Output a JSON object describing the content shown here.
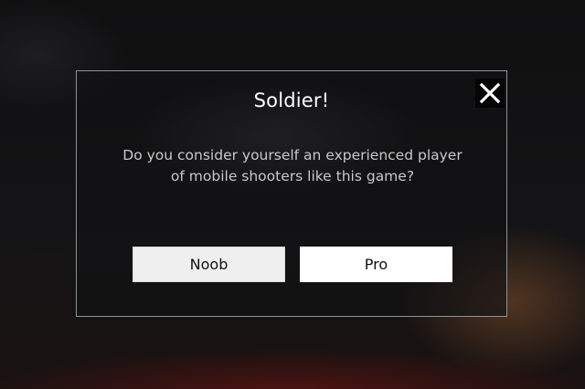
{
  "dialog": {
    "title": "Soldier!",
    "message_line1": "Do you consider yourself an experienced player",
    "message_line2": "of mobile shooters like this game?",
    "close_icon": "close-icon",
    "buttons": {
      "noob": "Noob",
      "pro": "Pro"
    }
  },
  "colors": {
    "dialog_border": "#8a9498",
    "title_text": "#ffffff",
    "message_text": "#c8c8c8",
    "noob_button_bg": "#efefef",
    "pro_button_bg": "#ffffff"
  }
}
